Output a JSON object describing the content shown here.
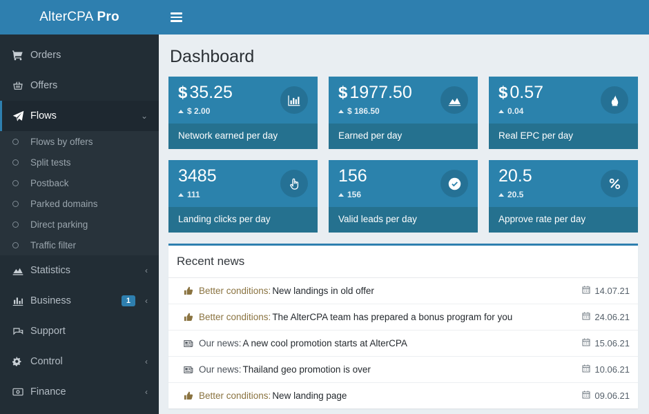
{
  "brand": {
    "name_light": "AlterCPA",
    "name_bold": "Pro"
  },
  "topbar": {
    "menu_icon": "hamburger-icon"
  },
  "page": {
    "title": "Dashboard"
  },
  "sidebar": {
    "items": [
      {
        "label": "Orders",
        "icon": "cart-icon",
        "chevron": "",
        "badge": "",
        "active": false
      },
      {
        "label": "Offers",
        "icon": "basket-icon",
        "chevron": "",
        "badge": "",
        "active": false
      },
      {
        "label": "Flows",
        "icon": "paper-plane-icon",
        "chevron": "⌄",
        "badge": "",
        "active": true
      },
      {
        "label": "Statistics",
        "icon": "area-chart-icon",
        "chevron": "‹",
        "badge": "",
        "active": false
      },
      {
        "label": "Business",
        "icon": "bar-chart-icon",
        "chevron": "‹",
        "badge": "1",
        "active": false
      },
      {
        "label": "Support",
        "icon": "comments-icon",
        "chevron": "",
        "badge": "",
        "active": false
      },
      {
        "label": "Control",
        "icon": "gears-icon",
        "chevron": "‹",
        "badge": "",
        "active": false
      },
      {
        "label": "Finance",
        "icon": "money-icon",
        "chevron": "‹",
        "badge": "",
        "active": false
      }
    ],
    "submenu": [
      {
        "label": "Flows by offers"
      },
      {
        "label": "Split tests"
      },
      {
        "label": "Postback"
      },
      {
        "label": "Parked domains"
      },
      {
        "label": "Direct parking"
      },
      {
        "label": "Traffic filter"
      }
    ]
  },
  "cards": [
    {
      "currency": "$",
      "value": "35.25",
      "delta": "$ 2.00",
      "label": "Network earned per day",
      "icon": "bar-chart-icon"
    },
    {
      "currency": "$",
      "value": "1977.50",
      "delta": "$ 186.50",
      "label": "Earned per day",
      "icon": "area-chart-icon"
    },
    {
      "currency": "$",
      "value": "0.57",
      "delta": "0.04",
      "label": "Real EPC per day",
      "icon": "fire-icon"
    },
    {
      "currency": "",
      "value": "3485",
      "delta": "111",
      "label": "Landing clicks per day",
      "icon": "hand-pointer-icon"
    },
    {
      "currency": "",
      "value": "156",
      "delta": "156",
      "label": "Valid leads per day",
      "icon": "check-circle-icon"
    },
    {
      "currency": "",
      "value": "20.5",
      "delta": "20.5",
      "label": "Approve rate per day",
      "icon": "percent-icon"
    }
  ],
  "news": {
    "heading": "Recent news",
    "rows": [
      {
        "icon": "thumbs-up-icon",
        "category": "Better conditions:",
        "title": "New landings in old offer",
        "date": "14.07.21",
        "kind": "good"
      },
      {
        "icon": "thumbs-up-icon",
        "category": "Better conditions:",
        "title": "The AlterCPA team has prepared a bonus program for you",
        "date": "24.06.21",
        "kind": "good"
      },
      {
        "icon": "newspaper-icon",
        "category": "Our news:",
        "title": "A new cool promotion starts at AlterCPA",
        "date": "15.06.21",
        "kind": "news"
      },
      {
        "icon": "newspaper-icon",
        "category": "Our news:",
        "title": "Thailand geo promotion is over",
        "date": "10.06.21",
        "kind": "news"
      },
      {
        "icon": "thumbs-up-icon",
        "category": "Better conditions:",
        "title": "New landing page",
        "date": "09.06.21",
        "kind": "good"
      }
    ]
  },
  "colors": {
    "brand_blue": "#2e7faf",
    "sidebar_dark": "#222d35",
    "card_body": "#2b82ac",
    "card_footer": "#25718f",
    "page_bg": "#e9eef2",
    "badge_blue": "#2e7faf",
    "category_good": "#8a7340"
  }
}
